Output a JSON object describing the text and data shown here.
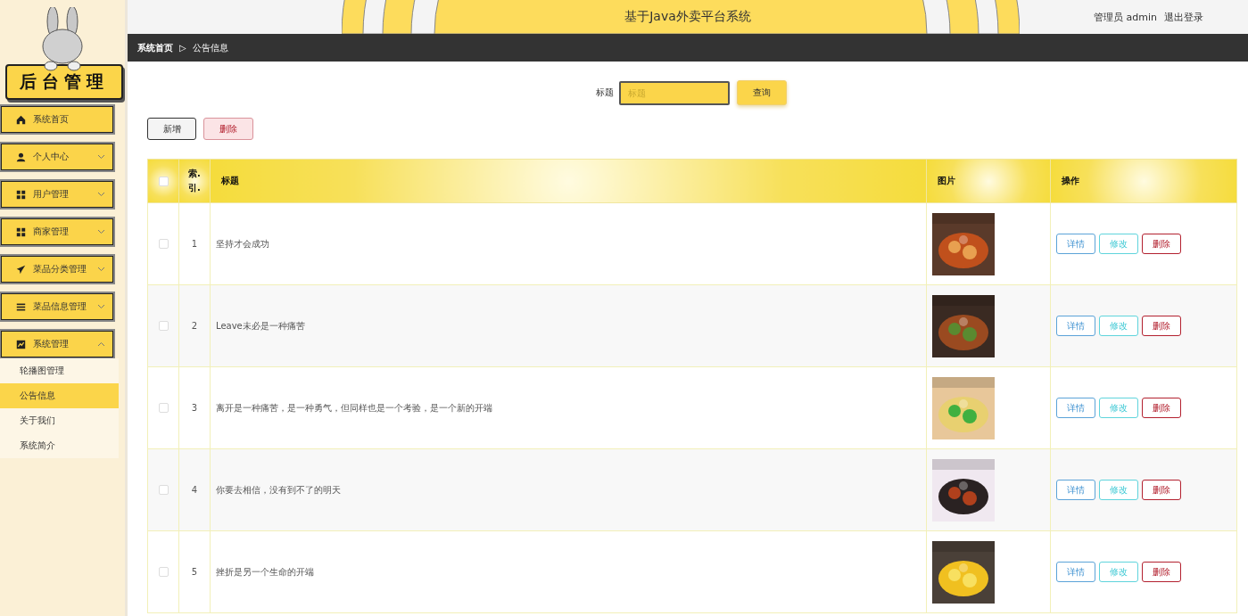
{
  "sidebar": {
    "logo_text": "后台管理",
    "menu": [
      {
        "label": "系统首页"
      },
      {
        "label": "个人中心",
        "expanded": false
      },
      {
        "label": "用户管理",
        "expanded": false
      },
      {
        "label": "商家管理",
        "expanded": false
      },
      {
        "label": "菜品分类管理",
        "expanded": false
      },
      {
        "label": "菜品信息管理",
        "expanded": false
      },
      {
        "label": "系统管理",
        "expanded": true,
        "children": [
          {
            "label": "轮播图管理",
            "selected": false
          },
          {
            "label": "公告信息",
            "selected": true
          },
          {
            "label": "关于我们",
            "selected": false
          },
          {
            "label": "系统简介",
            "selected": false
          }
        ]
      }
    ]
  },
  "header": {
    "title": "基于Java外卖平台系统",
    "user": "管理员 admin",
    "logout": "退出登录"
  },
  "breadcrumb": {
    "home": "系统首页",
    "separator": "▷",
    "current": "公告信息"
  },
  "search": {
    "label": "标题",
    "placeholder": "标题",
    "button": "查询"
  },
  "actions": [
    {
      "label": "新增",
      "kind": "add"
    },
    {
      "label": "删除",
      "kind": "delete"
    }
  ],
  "table": {
    "columns": [
      "索.\n引.",
      "标题",
      "图片",
      "操作"
    ],
    "header_checked": false,
    "rows": [
      {
        "index": "1",
        "title": "坚持才会成功",
        "checked": false,
        "picture": {
          "kind": "picture"
        },
        "actions": [
          {
            "label": "详情",
            "kind": "detail"
          },
          {
            "label": "修改",
            "kind": "edit"
          },
          {
            "label": "删除",
            "kind": "delete"
          }
        ]
      },
      {
        "index": "2",
        "title": "Leave未必是一种痛苦",
        "checked": false,
        "picture": {
          "kind": "picture"
        },
        "actions": [
          {
            "label": "详情",
            "kind": "detail"
          },
          {
            "label": "修改",
            "kind": "edit"
          },
          {
            "label": "删除",
            "kind": "delete"
          }
        ]
      },
      {
        "index": "3",
        "title": "离开是一种痛苦，是一种勇气，但同样也是一个考验，是一个新的开端",
        "checked": false,
        "picture": {
          "kind": "picture"
        },
        "actions": [
          {
            "label": "详情",
            "kind": "detail"
          },
          {
            "label": "修改",
            "kind": "edit"
          },
          {
            "label": "删除",
            "kind": "delete"
          }
        ]
      },
      {
        "index": "4",
        "title": "你要去相信，没有到不了的明天",
        "checked": false,
        "picture": {
          "kind": "picture"
        },
        "actions": [
          {
            "label": "详情",
            "kind": "detail"
          },
          {
            "label": "修改",
            "kind": "edit"
          },
          {
            "label": "删除",
            "kind": "delete"
          }
        ]
      },
      {
        "index": "5",
        "title": "挫折是另一个生命的开端",
        "checked": false,
        "picture": {
          "kind": "picture"
        },
        "actions": [
          {
            "label": "详情",
            "kind": "detail"
          },
          {
            "label": "修改",
            "kind": "edit"
          },
          {
            "label": "删除",
            "kind": "delete"
          }
        ]
      }
    ]
  }
}
